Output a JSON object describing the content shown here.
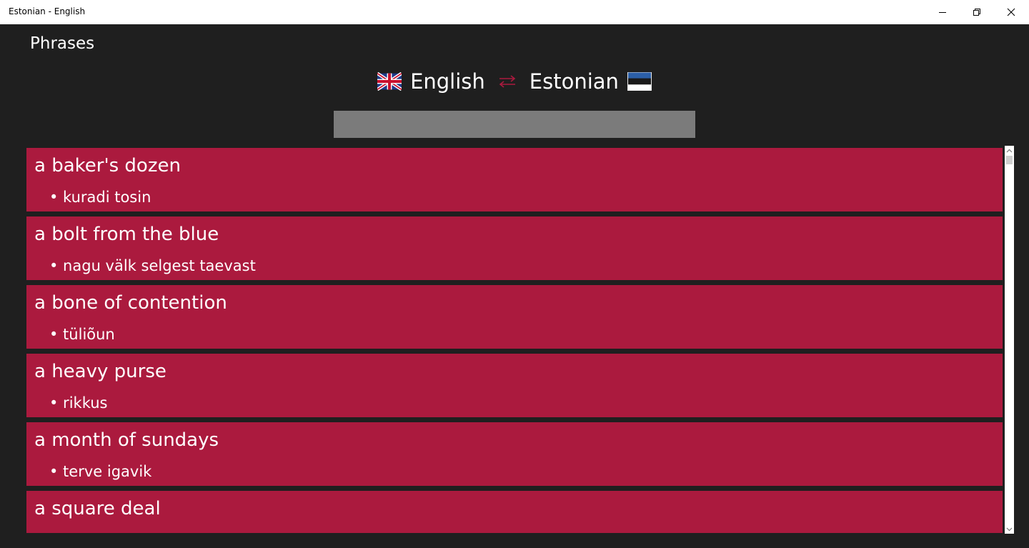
{
  "window": {
    "title": "Estonian - English"
  },
  "page": {
    "title": "Phrases"
  },
  "languages": {
    "source": "English",
    "target": "Estonian",
    "swap_color": "#ab1a3e"
  },
  "search": {
    "value": "",
    "placeholder": ""
  },
  "phrases": [
    {
      "phrase": "a baker's dozen",
      "translation": "• kuradi tosin"
    },
    {
      "phrase": "a bolt from the blue",
      "translation": "• nagu välk selgest taevast"
    },
    {
      "phrase": "a bone of contention",
      "translation": "• tüliõun"
    },
    {
      "phrase": "a heavy purse",
      "translation": "• rikkus"
    },
    {
      "phrase": "a month of sundays",
      "translation": "• terve igavik"
    },
    {
      "phrase": "a square deal",
      "translation": ""
    }
  ],
  "colors": {
    "background": "#1f1f1f",
    "accent": "#ab1a3e",
    "search_bg": "#7b7b7b"
  }
}
